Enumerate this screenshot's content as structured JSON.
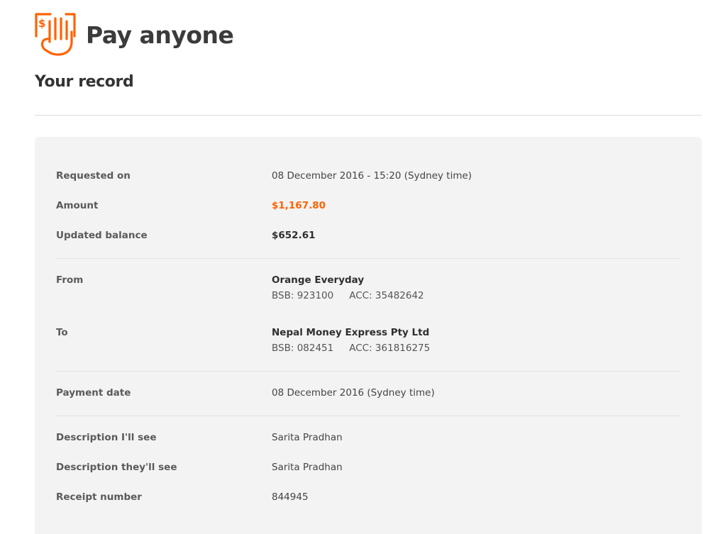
{
  "header": {
    "title": "Pay anyone",
    "icon": "pay-anyone-hand-icon"
  },
  "section_title": "Your record",
  "colors": {
    "accent": "#ff6200",
    "text_dark": "#333333",
    "card_bg": "#f3f3f3"
  },
  "record": {
    "requested_on": {
      "label": "Requested on",
      "value": "08 December 2016 - 15:20 (Sydney time)"
    },
    "amount": {
      "label": "Amount",
      "value": "$1,167.80"
    },
    "updated_balance": {
      "label": "Updated balance",
      "value": "$652.61"
    },
    "from": {
      "label": "From",
      "name": "Orange Everyday",
      "bsb": "BSB: 923100",
      "acc": "ACC: 35482642"
    },
    "to": {
      "label": "To",
      "name": "Nepal Money Express Pty Ltd",
      "bsb": "BSB: 082451",
      "acc": "ACC: 361816275"
    },
    "payment_date": {
      "label": "Payment date",
      "value": "08 December 2016 (Sydney time)"
    },
    "description_mine": {
      "label": "Description I'll see",
      "value": "Sarita Pradhan"
    },
    "description_theirs": {
      "label": "Description they'll see",
      "value": "Sarita Pradhan"
    },
    "receipt_number": {
      "label": "Receipt number",
      "value": "844945"
    }
  }
}
